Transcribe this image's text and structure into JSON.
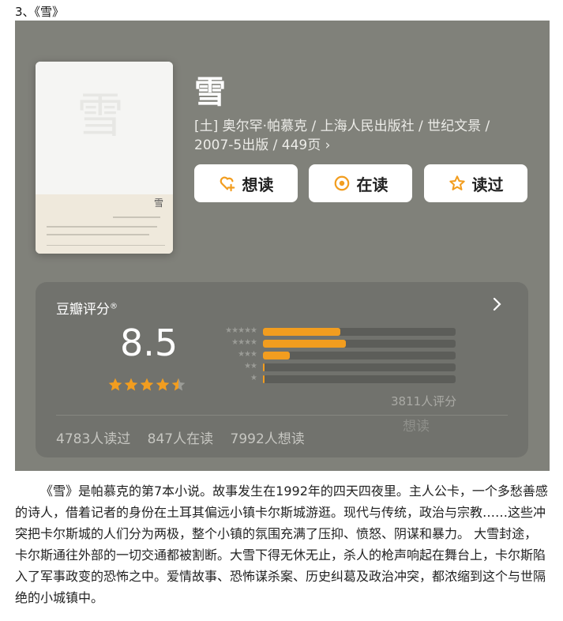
{
  "heading": "3、《雪》",
  "book": {
    "title": "雪",
    "meta": "[土] 奥尔罕·帕慕克 / 上海人民出版社 / 世纪文景 / 2007-5出版 / 449页",
    "chevron": "›",
    "cover_glyph": "雪",
    "cover_small_glyph": "雪"
  },
  "buttons": {
    "want_read": "想读",
    "reading": "在读",
    "read": "读过"
  },
  "rating": {
    "label": "豆瓣评分",
    "registered": "®",
    "score": "8.5",
    "stars": 4.5,
    "count_text": "3811人评分",
    "distribution": [
      {
        "label": "★★★★★",
        "percent": 40.0
      },
      {
        "label": "★★★★",
        "percent": 43.0
      },
      {
        "label": "★★★",
        "percent": 14.0
      },
      {
        "label": "★★",
        "percent": 1.0
      },
      {
        "label": "★",
        "percent": 0.5
      }
    ],
    "stats": {
      "read": "4783人读过",
      "reading": "847人在读",
      "want": "7992人想读"
    },
    "faded_overlay": "想读"
  },
  "description": "《雪》是帕慕克的第7本小说。故事发生在1992年的四天四夜里。主人公卡，一个多愁善感的诗人，借着记者的身份在土耳其偏远小镇卡尔斯城游逛。现代与传统，政治与宗教……这些冲突把卡尔斯城的人们分为两极，整个小镇的氛围充满了压抑、愤怒、阴谋和暴力。 大雪封途，卡尔斯通往外部的一切交通都被割断。大雪下得无休无止，杀人的枪声响起在舞台上，卡尔斯陷入了军事政变的恐怖之中。爱情故事、恐怖谋杀案、历史纠葛及政治冲突，都浓缩到这个与世隔绝的小城镇中。",
  "colors": {
    "accent": "#f29d1f",
    "panel": "#80817a",
    "card": "#71726d"
  },
  "icons": {
    "want": "heart-plus-icon",
    "reading": "target-circle-icon",
    "read": "star-outline-icon"
  }
}
